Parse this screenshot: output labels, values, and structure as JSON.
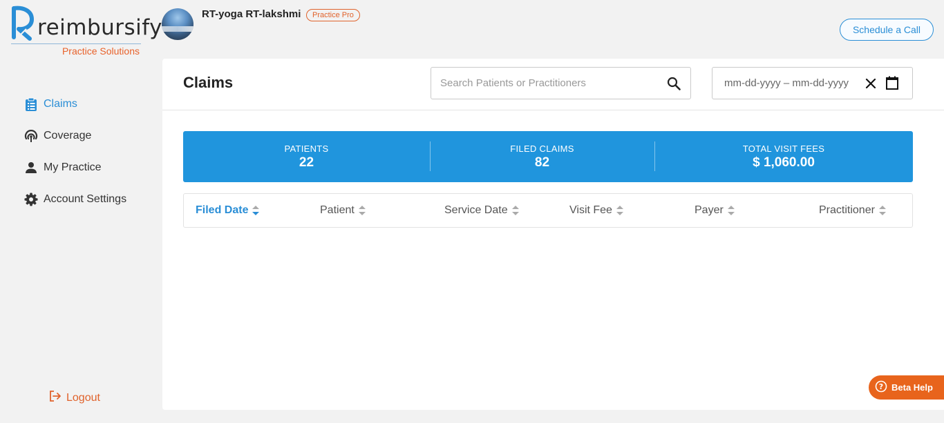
{
  "brand": {
    "name": "reimbursify",
    "subtitle": "Practice Solutions"
  },
  "user": {
    "name": "RT-yoga RT-lakshmi",
    "plan_badge": "Practice Pro"
  },
  "header": {
    "schedule_label": "Schedule a Call"
  },
  "sidebar": {
    "items": [
      {
        "label": "Claims",
        "icon": "clipboard-icon",
        "active": true
      },
      {
        "label": "Coverage",
        "icon": "coverage-icon",
        "active": false
      },
      {
        "label": "My Practice",
        "icon": "person-icon",
        "active": false
      },
      {
        "label": "Account Settings",
        "icon": "gear-icon",
        "active": false
      }
    ],
    "logout_label": "Logout"
  },
  "main": {
    "title": "Claims",
    "search": {
      "placeholder": "Search Patients or Practitioners",
      "value": ""
    },
    "date_range": {
      "placeholder": "mm-dd-yyyy – mm-dd-yyyy"
    },
    "stats": [
      {
        "label": "PATIENTS",
        "value": "22"
      },
      {
        "label": "FILED CLAIMS",
        "value": "82"
      },
      {
        "label": "TOTAL VISIT FEES",
        "value": "$ 1,060.00"
      }
    ],
    "columns": [
      {
        "label": "Filed Date",
        "active": true,
        "sort": "descending"
      },
      {
        "label": "Patient",
        "active": false,
        "sort": "none"
      },
      {
        "label": "Service Date",
        "active": false,
        "sort": "none"
      },
      {
        "label": "Visit Fee",
        "active": false,
        "sort": "none"
      },
      {
        "label": "Payer",
        "active": false,
        "sort": "none"
      },
      {
        "label": "Practitioner",
        "active": false,
        "sort": "none"
      }
    ]
  },
  "help": {
    "label": "Beta Help"
  },
  "colors": {
    "primary": "#2095dd",
    "accent": "#e0622b",
    "background": "#f2f2f2"
  }
}
